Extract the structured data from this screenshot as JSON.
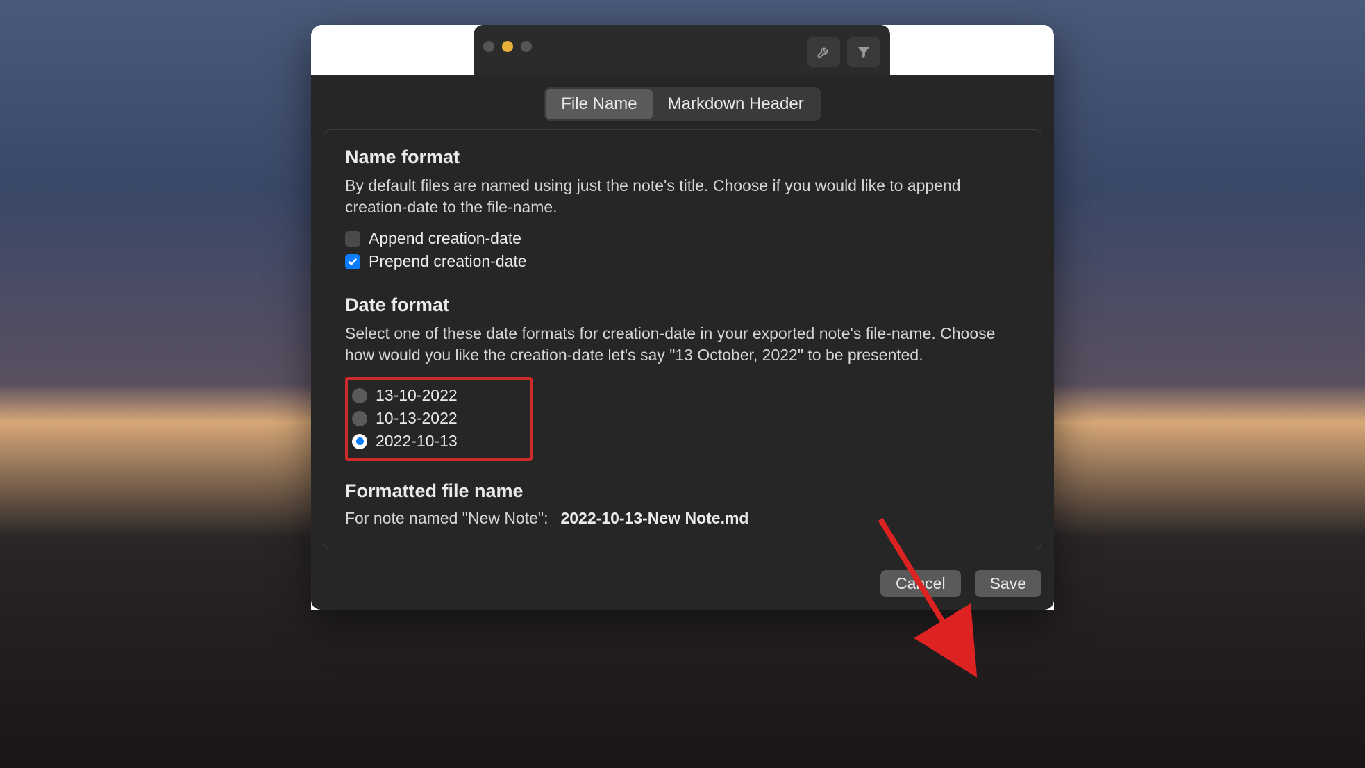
{
  "tabs": {
    "file_name": "File Name",
    "markdown_header": "Markdown Header"
  },
  "name_format": {
    "heading": "Name format",
    "description": "By default files are named using just the note's title. Choose if you would like to append creation-date to the file-name.",
    "append_label": "Append creation-date",
    "prepend_label": "Prepend creation-date",
    "append_checked": false,
    "prepend_checked": true
  },
  "date_format": {
    "heading": "Date format",
    "description": "Select one of these date formats for creation-date in your exported note's file-name. Choose how would you like the creation-date let's say \"13 October, 2022\" to be presented.",
    "options": {
      "opt0": "13-10-2022",
      "opt1": "10-13-2022",
      "opt2": "2022-10-13"
    },
    "selected_index": 2
  },
  "formatted": {
    "heading": "Formatted file name",
    "label": "For note named \"New Note\":",
    "value": "2022-10-13-New Note.md"
  },
  "buttons": {
    "cancel": "Cancel",
    "save": "Save"
  }
}
